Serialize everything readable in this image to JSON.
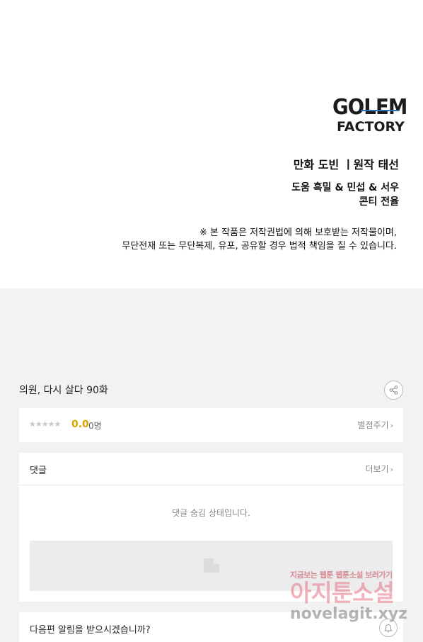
{
  "credits": {
    "logo_line1": "GOLEM",
    "logo_line2": "FACTORY",
    "artist": "만화 도빈 ㅣ원작 태선",
    "assist_line1": "도움 흑밀 & 민섭 & 서우",
    "assist_line2": "콘티 전율",
    "notice_line1": "※ 본 작품은 저작권법에 의해 보호받는 저작물이며,",
    "notice_line2": "무단전재 또는 무단복제, 유포, 공유할 경우 법적 책임을 질 수 있습니다."
  },
  "episode": {
    "title": "의원, 다시 살다 90화",
    "share_icon": "share-icon"
  },
  "rating": {
    "stars": "★★★★★",
    "score": "0.0",
    "count": "0명",
    "rate_link": "별점주기",
    "value": 0
  },
  "comments": {
    "label": "댓글",
    "more_link": "더보기",
    "hidden_message": "댓글 숨김 상태입니다."
  },
  "notify": {
    "text": "다음편 알림을 받으시겠습니까?",
    "bell_icon": "bell-icon"
  },
  "watermark": {
    "top": "지금보는 웹툰 웹툰소설 보러가기",
    "big": "아지툰소설",
    "url": "novelagit.xyz"
  },
  "colors": {
    "accent_score": "#d9a400",
    "logo_bar": "#2c6fb5",
    "watermark_pink": "#e77585"
  }
}
